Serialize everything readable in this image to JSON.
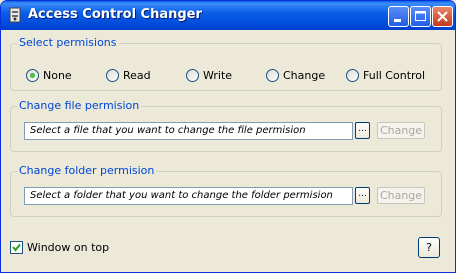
{
  "window": {
    "title": "Access Control Changer",
    "app_icon": "app-icon",
    "buttons": [
      "minimize-icon",
      "maximize-icon",
      "close-icon"
    ]
  },
  "permissions": {
    "legend": "Select permisions",
    "options": [
      {
        "label": "None",
        "selected": true
      },
      {
        "label": "Read",
        "selected": false
      },
      {
        "label": "Write",
        "selected": false
      },
      {
        "label": "Change",
        "selected": false
      },
      {
        "label": "Full Control",
        "selected": false
      }
    ]
  },
  "file": {
    "legend": "Change file permision",
    "path_value": "Select a file that you want to change the file permision",
    "browse_label": "...",
    "change_label": "Change"
  },
  "folder": {
    "legend": "Change folder permision",
    "path_value": "Select a folder that you want to change the folder permision",
    "browse_label": "...",
    "change_label": "Change"
  },
  "footer": {
    "window_on_top_label": "Window on top",
    "window_on_top_checked": true,
    "help_label": "?"
  },
  "colors": {
    "titlebar": "#0a5fe8",
    "group_legend": "#0046d5",
    "disabled_text": "#aca899"
  }
}
